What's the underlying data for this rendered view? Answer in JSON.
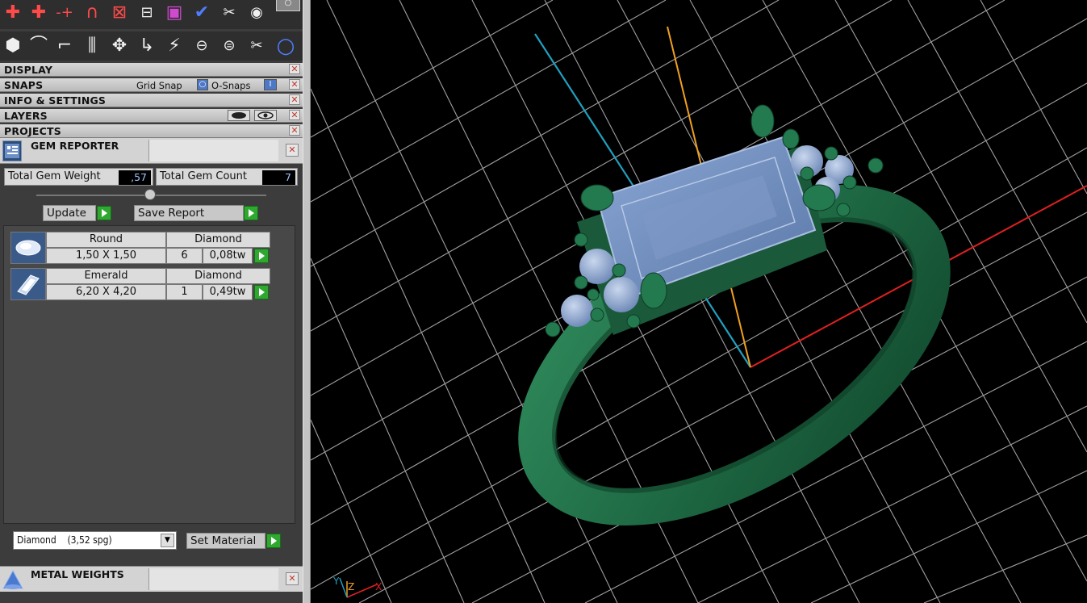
{
  "toolbar": {
    "row1_icons": [
      "add-point-icon",
      "add-point-snap-icon",
      "add-point-line-icon",
      "arc-point-icon",
      "remove-point-icon",
      "group-link-icon",
      "material-icon",
      "check-icon",
      "scale-icon",
      "gem-shape-icon",
      "view-mode-icon"
    ],
    "row2_icons": [
      "boolean-icon",
      "curve-icon",
      "offset-curve-icon",
      "mirror-icon",
      "move-icon",
      "rotate-icon",
      "sweep-icon",
      "link-icon",
      "unlink-icon",
      "cut-icon",
      "circle-icon"
    ]
  },
  "sections": {
    "display": {
      "title": "DISPLAY"
    },
    "snaps": {
      "title": "SNAPS",
      "grid_snap": "Grid Snap",
      "o_snaps": "O-Snaps"
    },
    "info": {
      "title": "INFO & SETTINGS"
    },
    "layers": {
      "title": "LAYERS"
    },
    "projects": {
      "title": "PROJECTS"
    }
  },
  "gem_reporter": {
    "title": "GEM REPORTER",
    "total_weight_label": "Total Gem Weight",
    "total_weight_value": ",57",
    "total_count_label": "Total Gem Count",
    "total_count_value": "7",
    "update_label": "Update",
    "save_report_label": "Save Report",
    "gems": [
      {
        "shape": "Round",
        "material": "Diamond",
        "size": "1,50 X 1,50",
        "count": "6",
        "weight": "0,08tw"
      },
      {
        "shape": "Emerald",
        "material": "Diamond",
        "size": "6,20 X 4,20",
        "count": "1",
        "weight": "0,49tw"
      }
    ],
    "material_select": "Diamond    (3,52 spg)",
    "set_material_label": "Set Material"
  },
  "metal_weights": {
    "title": "METAL WEIGHTS"
  },
  "close_glyph": "✕",
  "axis_labels": {
    "x": "X",
    "y": "Y",
    "z": "Z"
  },
  "colors": {
    "ring": "#1f6b45",
    "gem": "#6f8fbf",
    "axis_x": "#e02020",
    "axis_y": "#f0a020",
    "axis_z": "#20a0c0",
    "grid": "#bdbdbd"
  }
}
